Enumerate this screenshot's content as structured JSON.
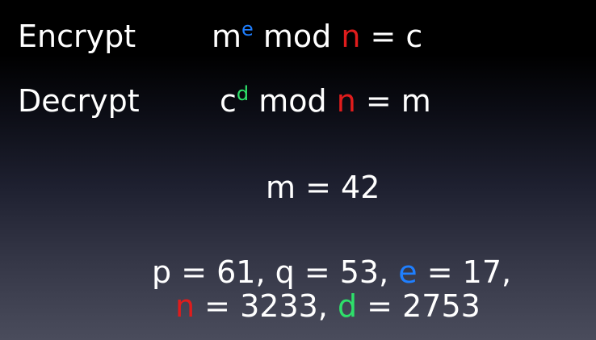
{
  "slide": {
    "encrypt": {
      "label": "Encrypt",
      "formula": {
        "base": "m",
        "exponent": "e",
        "mod": " mod ",
        "modulus": "n",
        "result": " = c"
      }
    },
    "decrypt": {
      "label": "Decrypt",
      "formula": {
        "base": "c",
        "exponent": "d",
        "mod": " mod ",
        "modulus": "n",
        "result": " = m"
      }
    },
    "message": "m = 42",
    "params": {
      "p": "p = 61, ",
      "q": "q = 53, ",
      "e_name": "e",
      "e_value": " = 17,",
      "n_name": "n",
      "n_value": " = 3233, ",
      "d_name": "d",
      "d_value": " = 2753"
    }
  },
  "colors": {
    "background_top": "#000000",
    "background_bottom": "#4a4c5c",
    "text": "#ffffff",
    "exponent_e": "#1f7fff",
    "modulus_n": "#e01c1c",
    "exponent_d": "#2ee06a"
  }
}
